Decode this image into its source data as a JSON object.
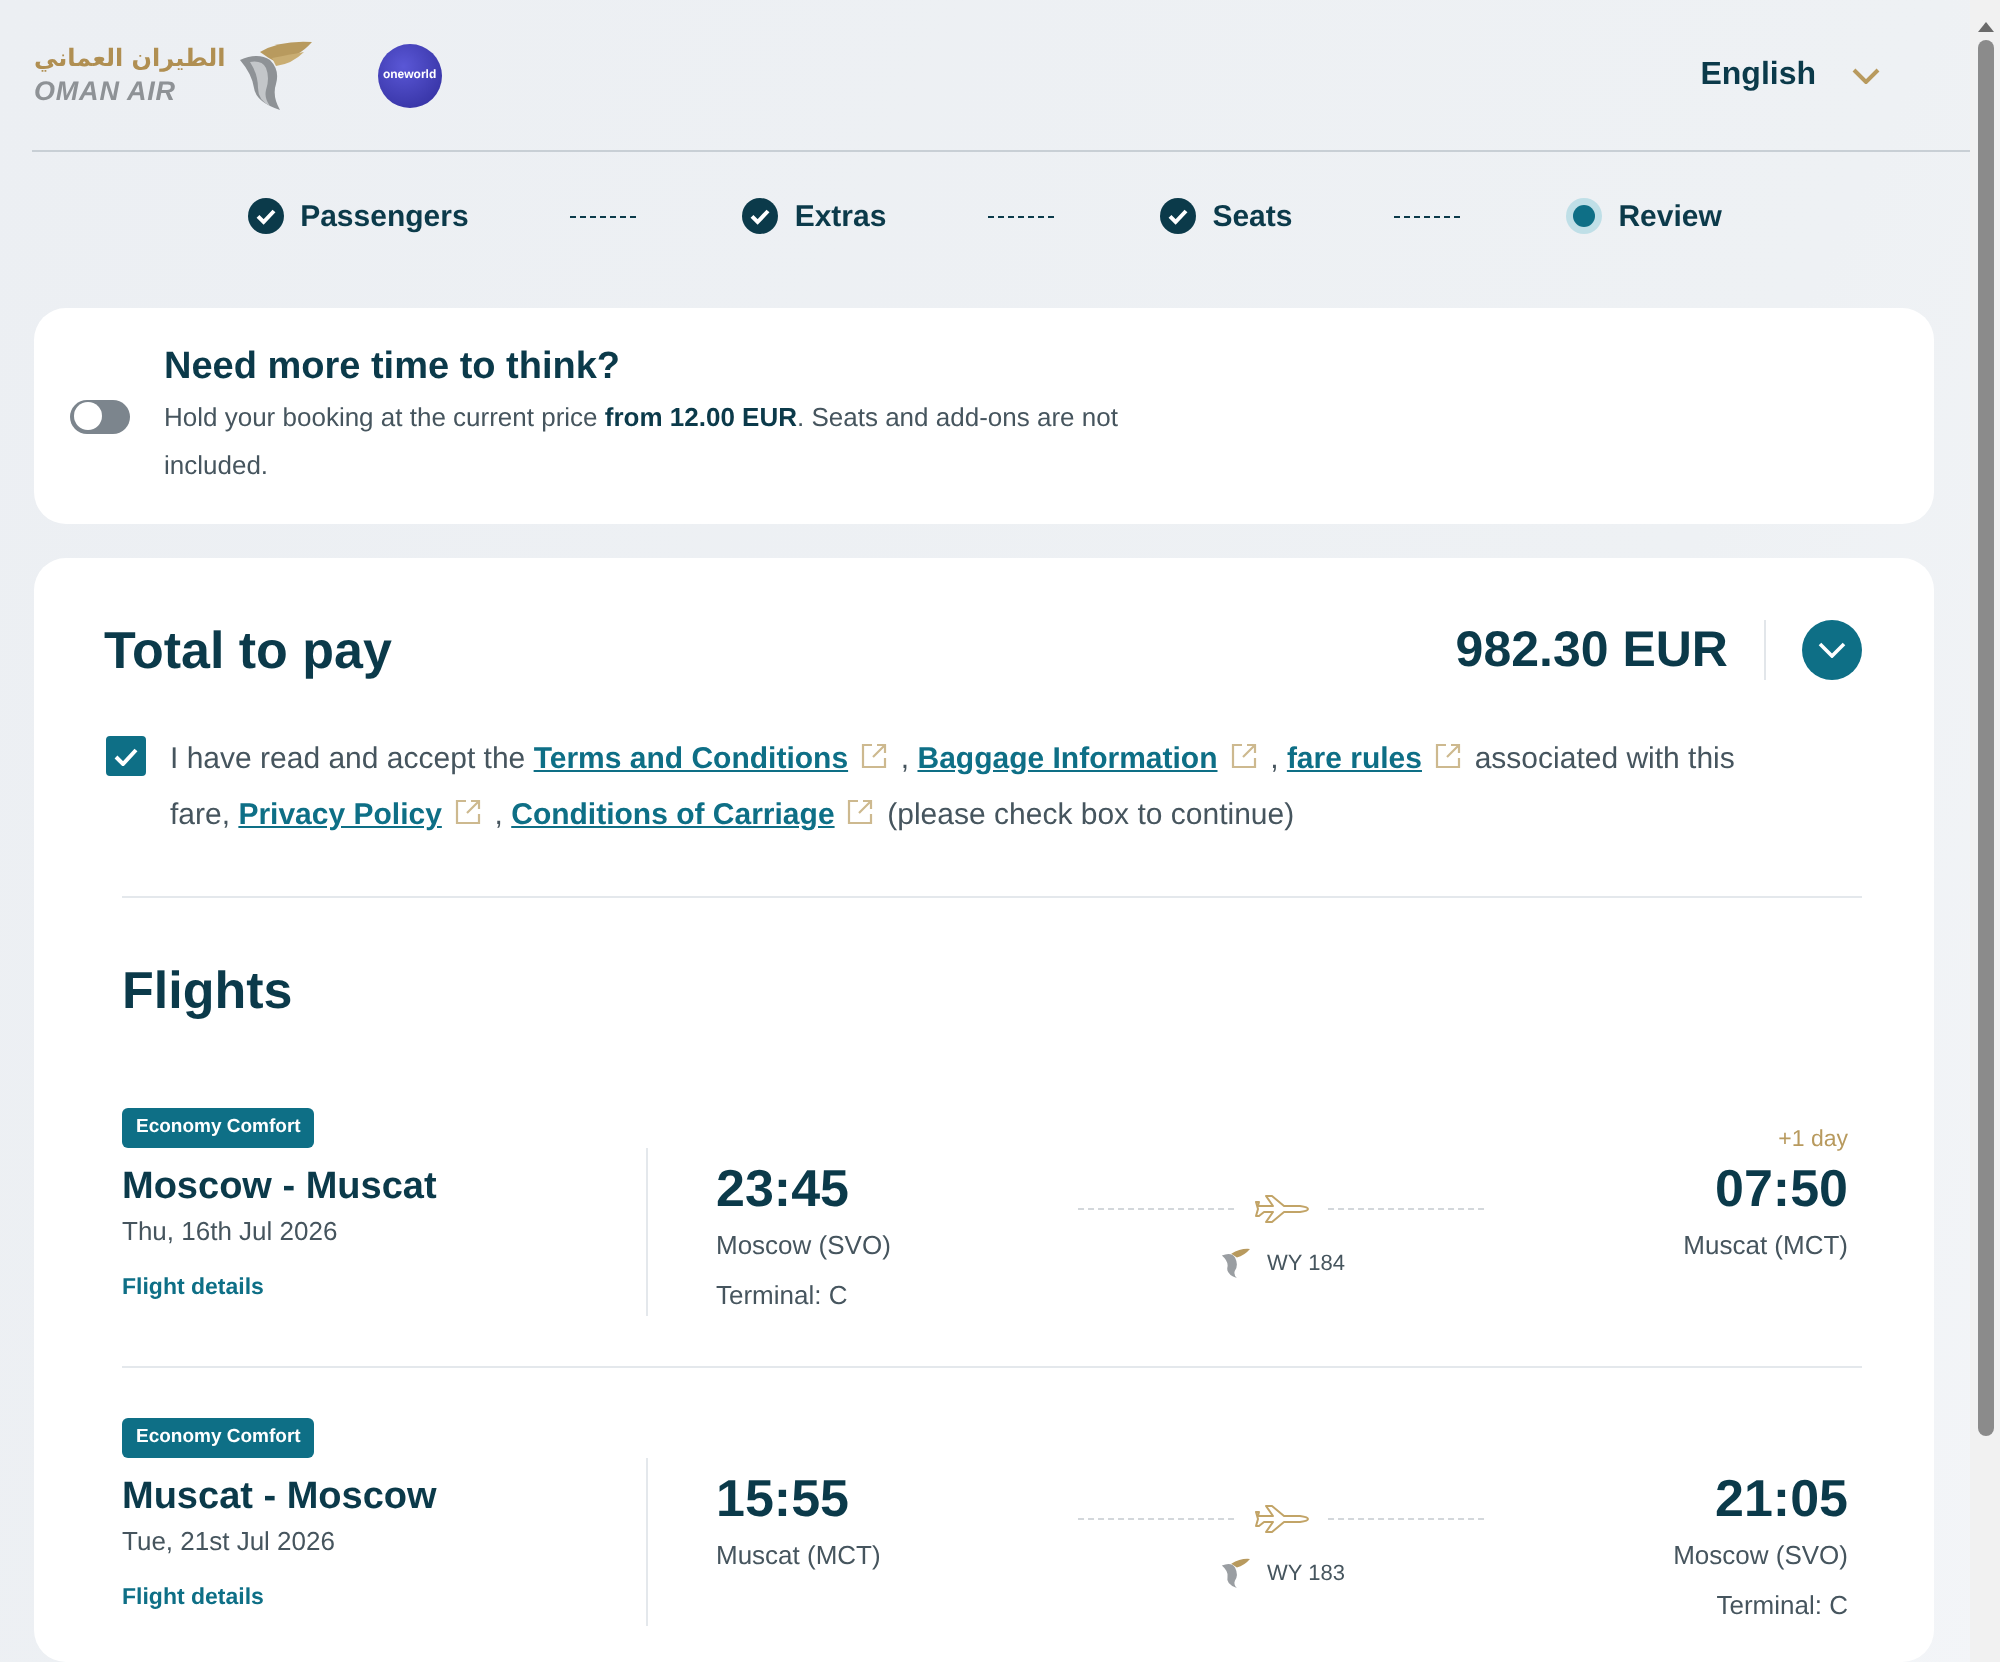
{
  "header": {
    "logo": {
      "arabic_name": "الطيران العماني",
      "name": "OMAN AIR"
    },
    "alliance_badge": {
      "label": "oneworld"
    },
    "language": {
      "label": "English"
    }
  },
  "stepper": [
    {
      "label": "Passengers",
      "completed": true,
      "selected": false
    },
    {
      "label": "Extras",
      "completed": true,
      "selected": false
    },
    {
      "label": "Seats",
      "completed": true,
      "selected": false
    },
    {
      "label": "Review",
      "completed": false,
      "selected": true
    }
  ],
  "hold_offer": {
    "on": false,
    "title": "Need more time to think?",
    "text": "Hold your booking at the current price **from 12.00 EUR**. Seats and add-ons are not included."
  },
  "total": {
    "label": "Total to pay",
    "amount": "982.30 EUR",
    "expanded": false
  },
  "consent": {
    "checked": true,
    "parts": [
      {
        "kind": "text",
        "text": "I have read and accept the"
      },
      {
        "kind": "link",
        "text": "Terms and Conditions"
      },
      {
        "kind": "text",
        "text": ","
      },
      {
        "kind": "link",
        "text": "Baggage Information"
      },
      {
        "kind": "text",
        "text": ","
      },
      {
        "kind": "link",
        "text": "fare rules"
      },
      {
        "kind": "text",
        "text": "associated with this fare,"
      },
      {
        "kind": "link",
        "text": "Privacy Policy"
      },
      {
        "kind": "text",
        "text": ","
      },
      {
        "kind": "link",
        "text": "Conditions of Carriage"
      },
      {
        "kind": "text",
        "text": "(please check box to continue)"
      }
    ]
  },
  "flights": {
    "title": "Flights",
    "items": [
      {
        "cabin": "Economy Comfort",
        "route": "Moscow - Muscat",
        "date": "Thu, 16th Jul 2026",
        "details_link": "Flight details",
        "departure": {
          "time": "23:45",
          "airport": "Moscow (SVO)",
          "terminal": "Terminal: C"
        },
        "flight_number": "WY 184",
        "arrival": {
          "day_offset": "+1 day",
          "time": "07:50",
          "airport": "Muscat (MCT)"
        }
      },
      {
        "cabin": "Economy Comfort",
        "route": "Muscat - Moscow",
        "date": "Tue, 21st Jul 2026",
        "details_link": "Flight details",
        "departure": {
          "time": "15:55",
          "airport": "Muscat (MCT)"
        },
        "flight_number": "WY 183",
        "arrival": {
          "time": "21:05",
          "airport": "Moscow (SVO)",
          "terminal": "Terminal: C"
        }
      }
    ]
  }
}
